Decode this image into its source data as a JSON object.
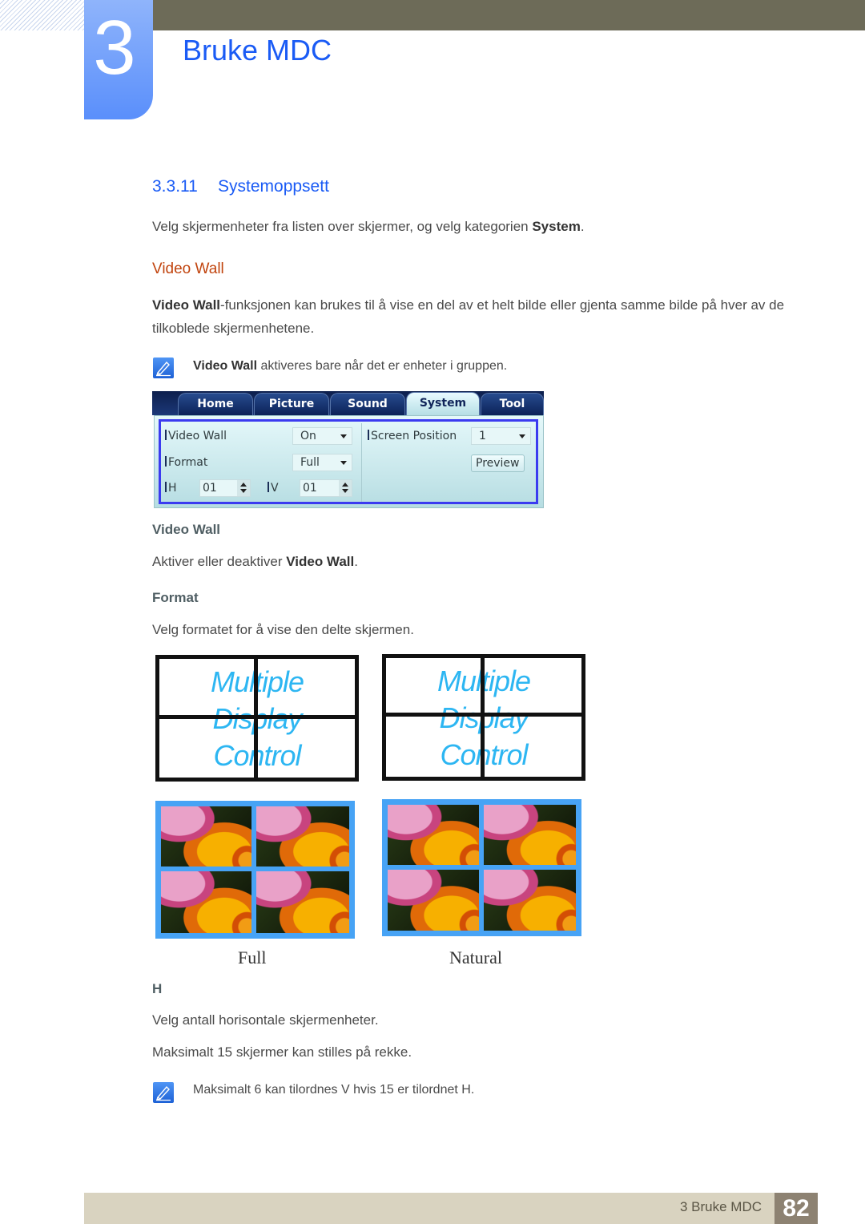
{
  "header": {
    "chapter_number": "3",
    "chapter_title": "Bruke MDC"
  },
  "section": {
    "number": "3.3.11",
    "title": "Systemoppsett"
  },
  "intro": {
    "text_before": "Velg skjermenheter fra listen over skjermer, og velg kategorien ",
    "bold": "System",
    "text_after": "."
  },
  "video_wall_heading": "Video Wall",
  "video_wall_desc": {
    "bold": "Video Wall",
    "line1": "-funksjonen kan brukes til å vise en del av et helt bilde eller gjenta samme bilde på hver av de",
    "line2": "tilkoblede skjermenhetene."
  },
  "note1": {
    "icon": "note-pencil-icon",
    "bold": "Video Wall",
    "text": " aktiveres bare når det er enheter i gruppen."
  },
  "mdc_ui": {
    "tabs": [
      {
        "label": "Home",
        "active": false
      },
      {
        "label": "Picture",
        "active": false
      },
      {
        "label": "Sound",
        "active": false
      },
      {
        "label": "System",
        "active": true
      },
      {
        "label": "Tool",
        "active": false
      }
    ],
    "video_wall_label": "Video Wall",
    "video_wall_value": "On",
    "format_label": "Format",
    "format_value": "Full",
    "h_label": "H",
    "h_value": "01",
    "v_label": "V",
    "v_value": "01",
    "screen_position_label": "Screen Position",
    "screen_position_value": "1",
    "preview_label": "Preview",
    "border_color": "#3b3bf0"
  },
  "video_wall_item": {
    "heading": "Video Wall",
    "text_before": "Aktiver eller deaktiver ",
    "bold": "Video Wall",
    "text_after": "."
  },
  "format_item": {
    "heading": "Format",
    "text": "Velg formatet for å vise den delte skjermen."
  },
  "illustrations": {
    "mdc_text": [
      "Multiple",
      "Display",
      "Control"
    ],
    "captions": [
      "Full",
      "Natural"
    ]
  },
  "h_item": {
    "heading": "H",
    "line1": "Velg antall horisontale skjermenheter.",
    "line2": "Maksimalt 15 skjermer kan stilles på rekke."
  },
  "note2": {
    "icon": "note-pencil-icon",
    "text": "Maksimalt 6 kan tilordnes V hvis 15 er tilordnet H."
  },
  "footer": {
    "text": "3 Bruke MDC",
    "page": "82"
  },
  "colors": {
    "accent_blue": "#1a5bf5",
    "accent_orange": "#c1440e",
    "topbar": "#6d6b58",
    "footer_bg": "#d9d3c0",
    "page_box": "#8d8272"
  }
}
